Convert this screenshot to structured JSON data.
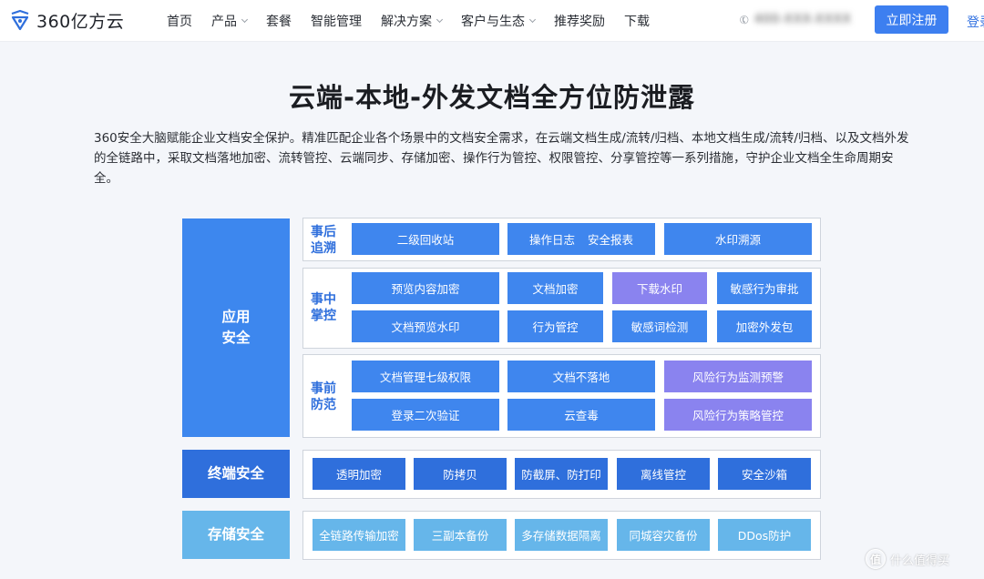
{
  "nav": {
    "logo_text": "360亿方云",
    "items": [
      {
        "label": "首页",
        "has_dropdown": false
      },
      {
        "label": "产品",
        "has_dropdown": true
      },
      {
        "label": "套餐",
        "has_dropdown": false
      },
      {
        "label": "智能管理",
        "has_dropdown": false
      },
      {
        "label": "解决方案",
        "has_dropdown": true
      },
      {
        "label": "客户与生态",
        "has_dropdown": true
      },
      {
        "label": "推荐奖励",
        "has_dropdown": false
      },
      {
        "label": "下载",
        "has_dropdown": false
      }
    ],
    "phone_blurred": "400-XXX-XXXX",
    "register_label": "立即注册",
    "login_label": "登录"
  },
  "main": {
    "title": "云端-本地-外发文档全方位防泄露",
    "description": "360安全大脑赋能企业文档安全保护。精准匹配企业各个场景中的文档安全需求，在云端文档生成/流转/归档、本地文档生成/流转/归档、以及文档外发的全链路中，采取文档落地加密、流转管控、云端同步、存储加密、操作行为管控、权限管控、分享管控等一系列措施，守护企业文档全生命周期安全。"
  },
  "diagram": {
    "categories": {
      "app": [
        "应用",
        "安全"
      ],
      "terminal": "终端安全",
      "storage": "存储安全"
    },
    "stages": {
      "after": [
        "事后",
        "追溯"
      ],
      "during": [
        "事中",
        "掌控"
      ],
      "before": [
        "事前",
        "防范"
      ]
    },
    "after_items": [
      "二级回收站",
      "操作日志",
      "安全报表",
      "水印溯源"
    ],
    "during_items": [
      "预览内容加密",
      "文档加密",
      "下载水印",
      "敏感行为审批",
      "文档预览水印",
      "行为管控",
      "敏感词检测",
      "加密外发包"
    ],
    "before_items": [
      "文档管理七级权限",
      "文档不落地",
      "风险行为监测预警",
      "登录二次验证",
      "云查毒",
      "风险行为策略管控"
    ],
    "terminal_items": [
      "透明加密",
      "防拷贝",
      "防截屏、防打印",
      "离线管控",
      "安全沙箱"
    ],
    "storage_items": [
      "全链路传输加密",
      "三副本备份",
      "多存储数据隔离",
      "同城容灾备份",
      "DDos防护"
    ]
  },
  "watermark": {
    "icon": "值",
    "text": "什么值得买"
  },
  "colors": {
    "primary": "#3d87ee",
    "dark_blue": "#2f6fdc",
    "light_blue": "#66b6ea",
    "purple": "#8a83ef",
    "register_button": "#3d7ff0"
  }
}
